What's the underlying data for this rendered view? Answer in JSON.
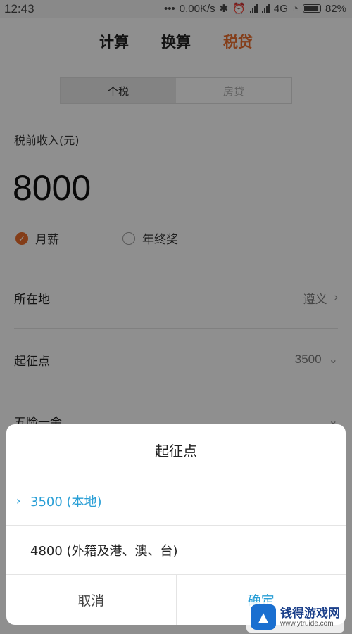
{
  "status": {
    "time": "12:43",
    "speed": "0.00K/s",
    "network": "4G",
    "battery": "82%"
  },
  "top_tabs": [
    {
      "label": "计算",
      "active": false
    },
    {
      "label": "换算",
      "active": false
    },
    {
      "label": "税贷",
      "active": true
    }
  ],
  "segment": [
    {
      "label": "个税",
      "active": true
    },
    {
      "label": "房贷",
      "active": false
    }
  ],
  "income": {
    "label": "税前收入(元)",
    "value": "8000"
  },
  "salary_type": [
    {
      "label": "月薪",
      "checked": true
    },
    {
      "label": "年终奖",
      "checked": false
    }
  ],
  "rows": {
    "location": {
      "label": "所在地",
      "value": "遵义"
    },
    "threshold": {
      "label": "起征点",
      "value": "3500"
    },
    "insurance": {
      "label": "五险一金"
    }
  },
  "dialog": {
    "title": "起征点",
    "options": [
      {
        "label": "3500 (本地)",
        "selected": true
      },
      {
        "label": "4800 (外籍及港、澳、台)",
        "selected": false
      }
    ],
    "cancel_label": "取消",
    "ok_label": "确定"
  },
  "watermark": {
    "name": "钱得游戏网",
    "url": "www.ytruide.com"
  },
  "colors": {
    "accent": "#e4692a",
    "dialog_accent": "#2a9fd6"
  }
}
